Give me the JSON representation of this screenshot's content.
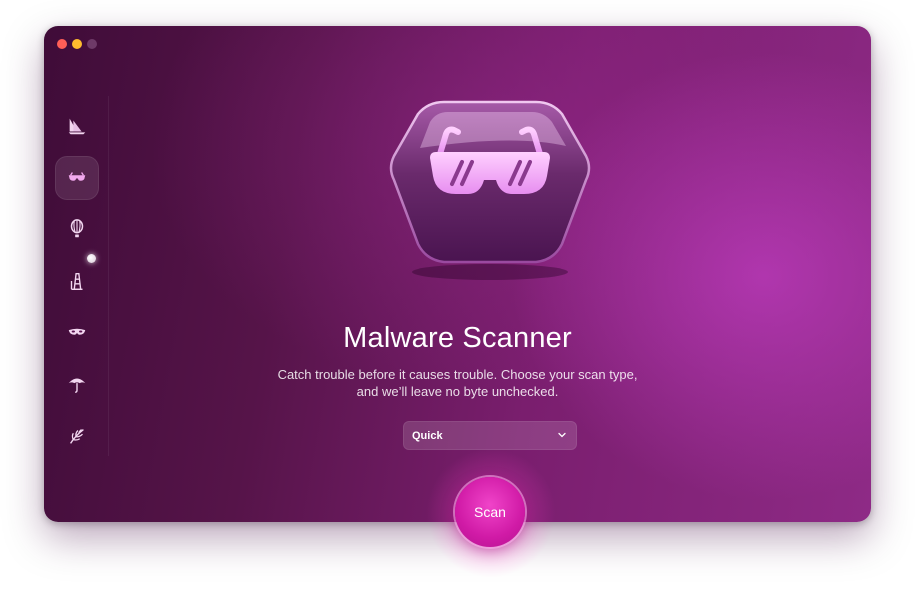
{
  "window": {
    "traffic_lights": [
      "close",
      "minimize",
      "zoom"
    ]
  },
  "sidebar": {
    "items": [
      {
        "id": "smart-scan",
        "icon": "sailboat-icon",
        "active": false
      },
      {
        "id": "protection",
        "icon": "sunglasses-icon",
        "active": true
      },
      {
        "id": "performance",
        "icon": "balloon-icon",
        "active": false
      },
      {
        "id": "applications",
        "icon": "tower-icon",
        "active": false,
        "notification": true
      },
      {
        "id": "privacy",
        "icon": "mask-icon",
        "active": false
      },
      {
        "id": "updater",
        "icon": "umbrella-icon",
        "active": false
      },
      {
        "id": "cleanup",
        "icon": "palm-leaf-icon",
        "active": false
      }
    ]
  },
  "main": {
    "title": "Malware Scanner",
    "subtitle_line1": "Catch trouble before it causes trouble. Choose your scan type,",
    "subtitle_line2": "and we’ll leave no byte unchecked.",
    "scan_type": {
      "selected": "Quick"
    },
    "scan_button_label": "Scan"
  },
  "colors": {
    "accent": "#d01aa6",
    "background_start": "#3f0c38",
    "background_end": "#8e2a86",
    "icon_tint": "#f2c8f4"
  }
}
